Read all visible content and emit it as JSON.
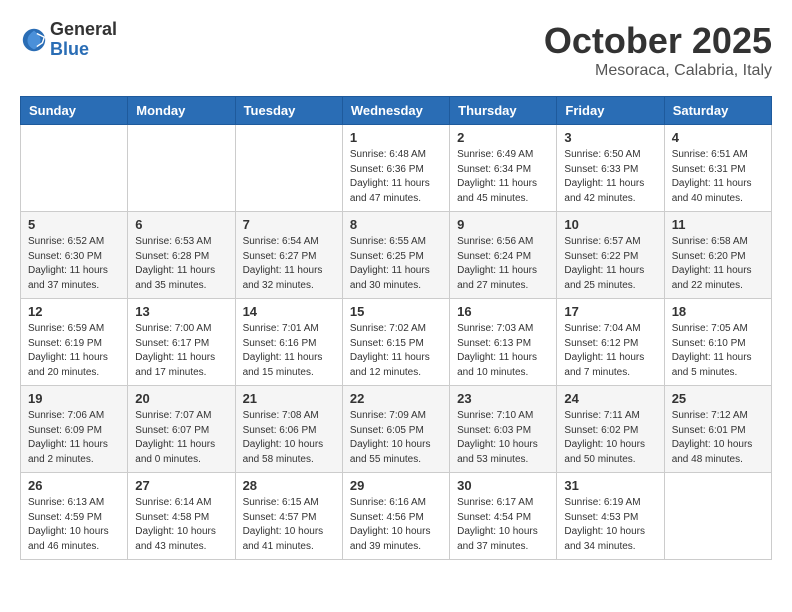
{
  "logo": {
    "general": "General",
    "blue": "Blue"
  },
  "title": "October 2025",
  "location": "Mesoraca, Calabria, Italy",
  "days_header": [
    "Sunday",
    "Monday",
    "Tuesday",
    "Wednesday",
    "Thursday",
    "Friday",
    "Saturday"
  ],
  "weeks": [
    [
      {
        "day": "",
        "info": ""
      },
      {
        "day": "",
        "info": ""
      },
      {
        "day": "",
        "info": ""
      },
      {
        "day": "1",
        "info": "Sunrise: 6:48 AM\nSunset: 6:36 PM\nDaylight: 11 hours\nand 47 minutes."
      },
      {
        "day": "2",
        "info": "Sunrise: 6:49 AM\nSunset: 6:34 PM\nDaylight: 11 hours\nand 45 minutes."
      },
      {
        "day": "3",
        "info": "Sunrise: 6:50 AM\nSunset: 6:33 PM\nDaylight: 11 hours\nand 42 minutes."
      },
      {
        "day": "4",
        "info": "Sunrise: 6:51 AM\nSunset: 6:31 PM\nDaylight: 11 hours\nand 40 minutes."
      }
    ],
    [
      {
        "day": "5",
        "info": "Sunrise: 6:52 AM\nSunset: 6:30 PM\nDaylight: 11 hours\nand 37 minutes."
      },
      {
        "day": "6",
        "info": "Sunrise: 6:53 AM\nSunset: 6:28 PM\nDaylight: 11 hours\nand 35 minutes."
      },
      {
        "day": "7",
        "info": "Sunrise: 6:54 AM\nSunset: 6:27 PM\nDaylight: 11 hours\nand 32 minutes."
      },
      {
        "day": "8",
        "info": "Sunrise: 6:55 AM\nSunset: 6:25 PM\nDaylight: 11 hours\nand 30 minutes."
      },
      {
        "day": "9",
        "info": "Sunrise: 6:56 AM\nSunset: 6:24 PM\nDaylight: 11 hours\nand 27 minutes."
      },
      {
        "day": "10",
        "info": "Sunrise: 6:57 AM\nSunset: 6:22 PM\nDaylight: 11 hours\nand 25 minutes."
      },
      {
        "day": "11",
        "info": "Sunrise: 6:58 AM\nSunset: 6:20 PM\nDaylight: 11 hours\nand 22 minutes."
      }
    ],
    [
      {
        "day": "12",
        "info": "Sunrise: 6:59 AM\nSunset: 6:19 PM\nDaylight: 11 hours\nand 20 minutes."
      },
      {
        "day": "13",
        "info": "Sunrise: 7:00 AM\nSunset: 6:17 PM\nDaylight: 11 hours\nand 17 minutes."
      },
      {
        "day": "14",
        "info": "Sunrise: 7:01 AM\nSunset: 6:16 PM\nDaylight: 11 hours\nand 15 minutes."
      },
      {
        "day": "15",
        "info": "Sunrise: 7:02 AM\nSunset: 6:15 PM\nDaylight: 11 hours\nand 12 minutes."
      },
      {
        "day": "16",
        "info": "Sunrise: 7:03 AM\nSunset: 6:13 PM\nDaylight: 11 hours\nand 10 minutes."
      },
      {
        "day": "17",
        "info": "Sunrise: 7:04 AM\nSunset: 6:12 PM\nDaylight: 11 hours\nand 7 minutes."
      },
      {
        "day": "18",
        "info": "Sunrise: 7:05 AM\nSunset: 6:10 PM\nDaylight: 11 hours\nand 5 minutes."
      }
    ],
    [
      {
        "day": "19",
        "info": "Sunrise: 7:06 AM\nSunset: 6:09 PM\nDaylight: 11 hours\nand 2 minutes."
      },
      {
        "day": "20",
        "info": "Sunrise: 7:07 AM\nSunset: 6:07 PM\nDaylight: 11 hours\nand 0 minutes."
      },
      {
        "day": "21",
        "info": "Sunrise: 7:08 AM\nSunset: 6:06 PM\nDaylight: 10 hours\nand 58 minutes."
      },
      {
        "day": "22",
        "info": "Sunrise: 7:09 AM\nSunset: 6:05 PM\nDaylight: 10 hours\nand 55 minutes."
      },
      {
        "day": "23",
        "info": "Sunrise: 7:10 AM\nSunset: 6:03 PM\nDaylight: 10 hours\nand 53 minutes."
      },
      {
        "day": "24",
        "info": "Sunrise: 7:11 AM\nSunset: 6:02 PM\nDaylight: 10 hours\nand 50 minutes."
      },
      {
        "day": "25",
        "info": "Sunrise: 7:12 AM\nSunset: 6:01 PM\nDaylight: 10 hours\nand 48 minutes."
      }
    ],
    [
      {
        "day": "26",
        "info": "Sunrise: 6:13 AM\nSunset: 4:59 PM\nDaylight: 10 hours\nand 46 minutes."
      },
      {
        "day": "27",
        "info": "Sunrise: 6:14 AM\nSunset: 4:58 PM\nDaylight: 10 hours\nand 43 minutes."
      },
      {
        "day": "28",
        "info": "Sunrise: 6:15 AM\nSunset: 4:57 PM\nDaylight: 10 hours\nand 41 minutes."
      },
      {
        "day": "29",
        "info": "Sunrise: 6:16 AM\nSunset: 4:56 PM\nDaylight: 10 hours\nand 39 minutes."
      },
      {
        "day": "30",
        "info": "Sunrise: 6:17 AM\nSunset: 4:54 PM\nDaylight: 10 hours\nand 37 minutes."
      },
      {
        "day": "31",
        "info": "Sunrise: 6:19 AM\nSunset: 4:53 PM\nDaylight: 10 hours\nand 34 minutes."
      },
      {
        "day": "",
        "info": ""
      }
    ]
  ]
}
